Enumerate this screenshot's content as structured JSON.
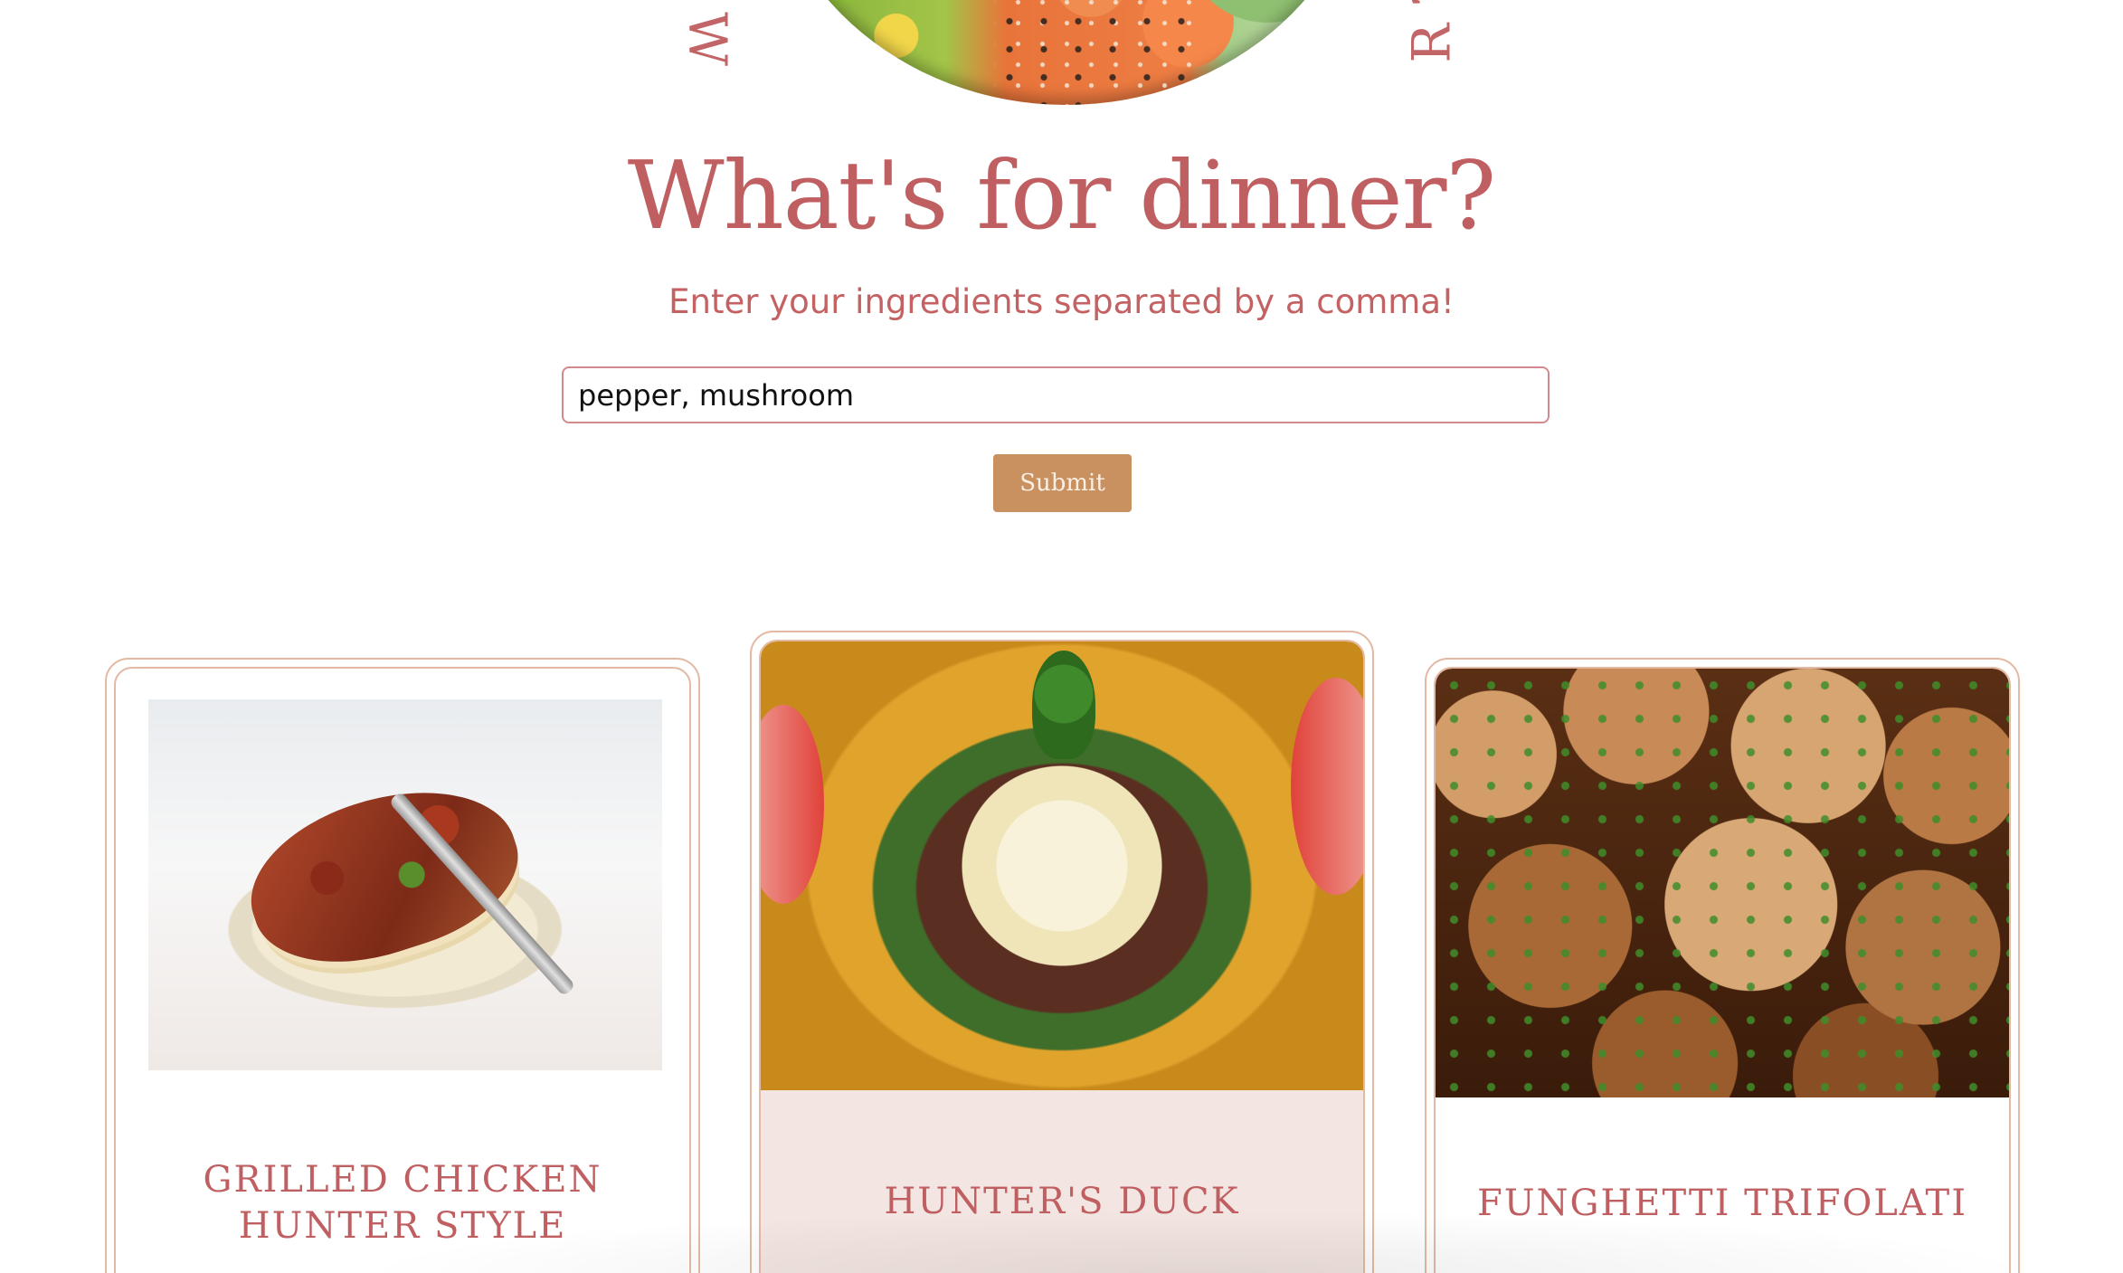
{
  "hero": {
    "ring_letter_left": "W",
    "ring_letter_right": "R ?"
  },
  "header": {
    "title": "What's for dinner?",
    "subtitle": "Enter your ingredients separated by a comma!"
  },
  "search": {
    "value": "pepper, mushroom",
    "submit_label": "Submit"
  },
  "recipes": [
    {
      "name": "GRILLED CHICKEN HUNTER STYLE"
    },
    {
      "name": "HUNTER'S DUCK"
    },
    {
      "name": "FUNGHETTI TRIFOLATI"
    }
  ],
  "colors": {
    "accent": "#c05f61",
    "button": "#c99160",
    "card_border": "#e3b9a3",
    "title_highlight": "#f2e2de"
  }
}
